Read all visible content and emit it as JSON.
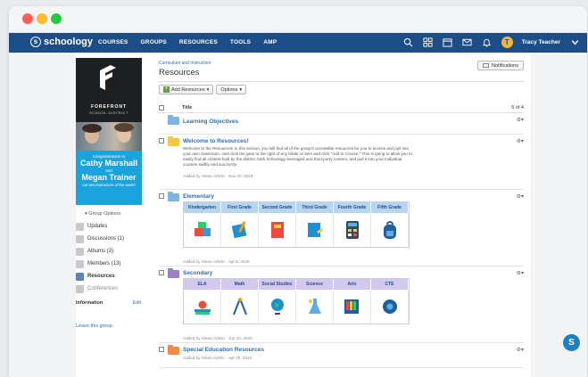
{
  "nav": {
    "logo": "schoology",
    "links": [
      "COURSES",
      "GROUPS",
      "RESOURCES",
      "TOOLS",
      "AMP"
    ],
    "avatar_initial": "T",
    "user_name": "Tracy Teacher"
  },
  "banner": {
    "school_name": "FOREFRONT",
    "school_sub": "SCHOOL DISTRICT",
    "congrats": "Congratulations to",
    "name1": "Cathy Marshall",
    "and": "and",
    "name2": "Megan Trainer",
    "note": "our two instructors of the week!"
  },
  "sidebar": {
    "group_options": "Group Options",
    "items": [
      {
        "label": "Updates"
      },
      {
        "label": "Discussions (1)"
      },
      {
        "label": "Albums (3)"
      },
      {
        "label": "Members (13)"
      },
      {
        "label": "Resources"
      },
      {
        "label": "Conferences"
      }
    ],
    "information": "Information",
    "edit": "Edit",
    "leave": "Leave this group"
  },
  "main": {
    "breadcrumb": "Curriculum and Instruction",
    "title": "Resources",
    "notifications": "Notifications",
    "add_resources": "Add Resources",
    "options": "Options",
    "col_title": "Title",
    "count": "5 of 4",
    "rows": [
      {
        "title": "Learning Objectives"
      },
      {
        "title": "Welcome to Resources!",
        "description": "Welcome to the Resources! In this section, you will find all of the group's accessible resources for you to access and pull into your own classroom. Just click the gear to the right of any folder or item and click \"Add to Course.\" This is going to allow you to easily find all content built by the district, both Schoology-leveraged and third-party content, and pull it into your individual courses swiftly and succinctly.",
        "meta": "Added by Alison Admin · Nov 20, 2019"
      },
      {
        "title": "Elementary",
        "grades": [
          "Kindergarten",
          "First Grade",
          "Second Grade",
          "Third Grade",
          "Fourth Grade",
          "Fifth Grade"
        ],
        "meta": "Added by Alison Admin · Apr 6, 2020"
      },
      {
        "title": "Secondary",
        "subjects": [
          "ELA",
          "Math",
          "Social Studies",
          "Science",
          "Arts",
          "CTE"
        ],
        "meta": "Added by Alison Admin · Jun 10, 2020"
      },
      {
        "title": "Special Education Resources",
        "meta": "Added by Alison Admin · Apr 20, 2020"
      }
    ]
  },
  "fab_label": "S",
  "colors": {
    "nav": "#1d4d87",
    "link": "#2a6ebb",
    "banner_blue": "#1aa3dc",
    "folder_yellow": "#f5c842",
    "folder_blue": "#7fb3e0",
    "folder_purple": "#9b7fc7",
    "folder_orange": "#f08a4b",
    "grid_blue_header": "#b8d4ef",
    "grid_purple_header": "#d3c9ec"
  }
}
